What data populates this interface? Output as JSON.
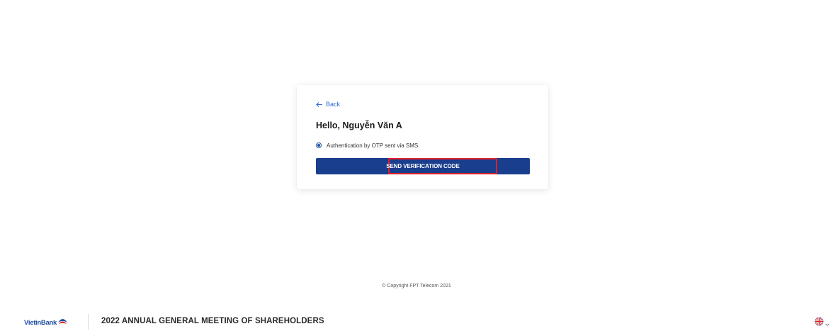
{
  "card": {
    "back_label": "Back",
    "greeting": "Hello, Nguyễn Văn A",
    "option_label": "Authentication by OTP sent via SMS",
    "send_button_label": "SEND VERIFICATION CODE"
  },
  "copyright": "© Copyright FPT Telecom 2021",
  "footer": {
    "logo_text": "VietinBank",
    "meeting_title": "2022 ANNUAL GENERAL MEETING OF SHAREHOLDERS",
    "language_icon": "uk-flag-icon"
  },
  "colors": {
    "primary": "#1a3e8e",
    "link": "#2e6bd6",
    "highlight": "#e0202a"
  }
}
